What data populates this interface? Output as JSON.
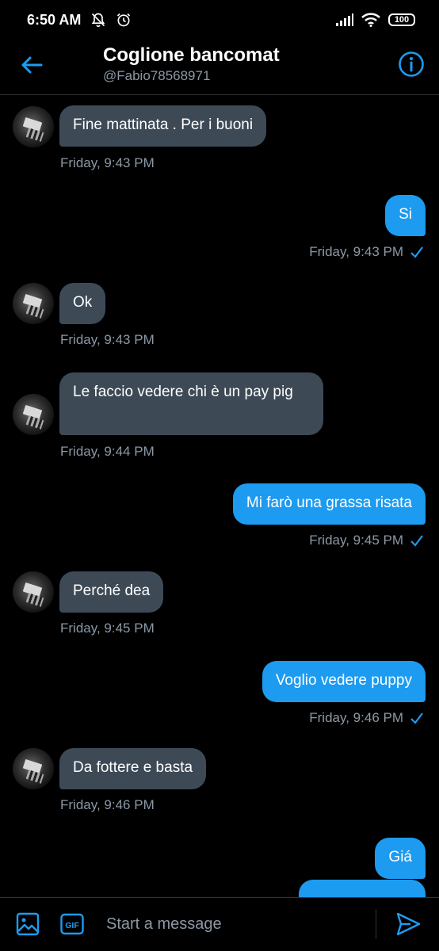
{
  "status": {
    "time": "6:50 AM",
    "battery": "100"
  },
  "header": {
    "title": "Coglione bancomat",
    "handle": "@Fabio78568971"
  },
  "messages": [
    {
      "dir": "in",
      "text": "Fine mattinata . Per i buoni",
      "time": "Friday, 9:43 PM"
    },
    {
      "dir": "out",
      "text": "Si",
      "time": "Friday, 9:43 PM"
    },
    {
      "dir": "in",
      "text": "Ok",
      "time": "Friday, 9:43 PM"
    },
    {
      "dir": "in",
      "text": "Le faccio vedere chi è un pay pig",
      "time": "Friday, 9:44 PM"
    },
    {
      "dir": "out",
      "text": "Mi farò una grassa risata",
      "time": "Friday, 9:45 PM"
    },
    {
      "dir": "in",
      "text": "Perché dea",
      "time": "Friday, 9:45 PM"
    },
    {
      "dir": "out",
      "text": "Voglio vedere puppy",
      "time": "Friday, 9:46 PM"
    },
    {
      "dir": "in",
      "text": "Da fottere e basta",
      "time": "Friday, 9:46 PM"
    },
    {
      "dir": "out",
      "text": "Giá",
      "time": ""
    }
  ],
  "composer": {
    "placeholder": "Start a message",
    "gif_label": "GIF"
  },
  "colors": {
    "accent": "#1d9bf0",
    "incoming_bubble": "#3d4a56",
    "muted_text": "#8b98a5",
    "background": "#000000"
  },
  "icons": [
    "back-arrow-icon",
    "info-icon",
    "image-icon",
    "gif-icon",
    "send-icon",
    "check-icon",
    "mute-bell-icon",
    "alarm-icon",
    "signal-icon",
    "wifi-icon",
    "battery-icon"
  ]
}
